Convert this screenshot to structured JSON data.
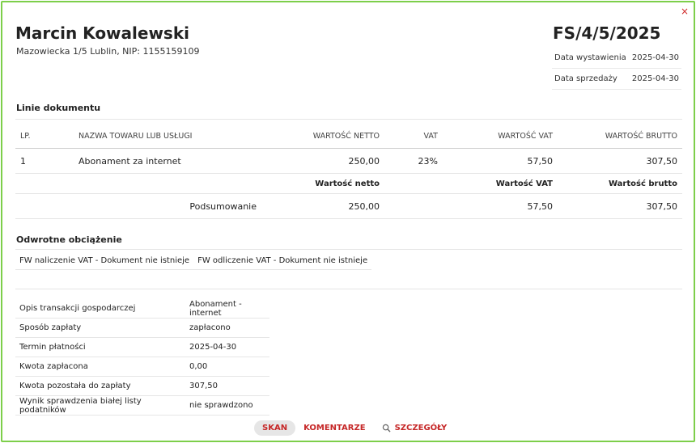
{
  "seller": {
    "name": "Marcin Kowalewski",
    "address": "Mazowiecka 1/5 Lublin, NIP: 1155159109"
  },
  "document": {
    "number": "FS/4/5/2025",
    "dates": [
      {
        "label": "Data wystawienia",
        "value": "2025-04-30"
      },
      {
        "label": "Data sprzedaży",
        "value": "2025-04-30"
      }
    ]
  },
  "lines_section": {
    "title": "Linie dokumentu",
    "headers": [
      "LP.",
      "NAZWA TOWARU LUB USŁUGI",
      "WARTOŚĆ NETTO",
      "VAT",
      "WARTOŚĆ VAT",
      "WARTOŚĆ BRUTTO"
    ],
    "rows": [
      {
        "lp": "1",
        "name": "Abonament za internet",
        "netto": "250,00",
        "vat": "23%",
        "vat_value": "57,50",
        "brutto": "307,50"
      }
    ],
    "summary_headers": {
      "netto": "Wartość netto",
      "vat": "Wartość VAT",
      "brutto": "Wartość brutto"
    },
    "summary": {
      "label": "Podsumowanie",
      "netto": "250,00",
      "vat": "57,50",
      "brutto": "307,50"
    }
  },
  "reverse_charge": {
    "title": "Odwrotne obciążenie",
    "items": [
      "FW naliczenie VAT - Dokument nie istnieje",
      "FW odliczenie VAT - Dokument nie istnieje"
    ]
  },
  "details": [
    {
      "label": "Opis transakcji gospodarczej",
      "value": "Abonament - internet"
    },
    {
      "label": "Sposób zapłaty",
      "value": "zapłacono"
    },
    {
      "label": "Termin płatności",
      "value": "2025-04-30"
    },
    {
      "label": "Kwota zapłacona",
      "value": "0,00"
    },
    {
      "label": "Kwota pozostała do zapłaty",
      "value": "307,50"
    },
    {
      "label": "Wynik sprawdzenia białej listy podatników",
      "value": "nie sprawdzono"
    }
  ],
  "actions": {
    "scan": "SKAN",
    "comments": "KOMENTARZE",
    "details": "SZCZEGÓŁY"
  },
  "close_symbol": "×",
  "colors": {
    "accent": "#c62828",
    "frame": "#7dcf4a"
  }
}
